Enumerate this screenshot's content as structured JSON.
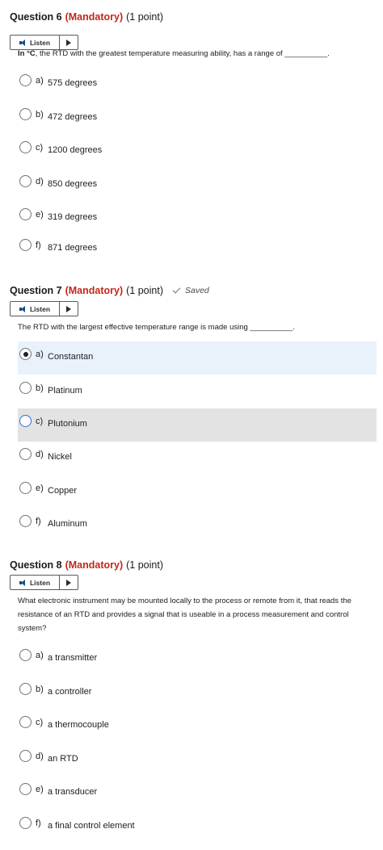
{
  "questions": [
    {
      "title": "Question 6",
      "mandatory": "(Mandatory)",
      "points": "(1 point)",
      "saved": "",
      "listen_label": "Listen",
      "text_bold": "In °C",
      "text": ", the RTD with the greatest temperature measuring ability, has a range of __________.",
      "options": [
        {
          "letter": "a)",
          "text": "575 degrees",
          "selected": false
        },
        {
          "letter": "b)",
          "text": "472 degrees",
          "selected": false
        },
        {
          "letter": "c)",
          "text": "1200 degrees",
          "selected": false
        },
        {
          "letter": "d)",
          "text": "850 degrees",
          "selected": false
        },
        {
          "letter": "e)",
          "text": "319 degrees",
          "selected": false
        },
        {
          "letter": "f)",
          "text": "871 degrees",
          "selected": false
        }
      ]
    },
    {
      "title": "Question 7",
      "mandatory": "(Mandatory)",
      "points": "(1 point)",
      "saved": "Saved",
      "listen_label": "Listen",
      "text_bold": "",
      "text": "The RTD with the largest effective temperature range is made using __________.",
      "options": [
        {
          "letter": "a)",
          "text": "Constantan",
          "selected": true
        },
        {
          "letter": "b)",
          "text": "Platinum",
          "selected": false
        },
        {
          "letter": "c)",
          "text": "Plutonium",
          "selected": false
        },
        {
          "letter": "d)",
          "text": "Nickel",
          "selected": false
        },
        {
          "letter": "e)",
          "text": "Copper",
          "selected": false
        },
        {
          "letter": "f)",
          "text": "Aluminum",
          "selected": false
        }
      ]
    },
    {
      "title": "Question 8",
      "mandatory": "(Mandatory)",
      "points": "(1 point)",
      "saved": "",
      "listen_label": "Listen",
      "text_bold": "",
      "text": "What electronic instrument may be mounted locally to the process or remote from it, that reads the resistance of an RTD and provides a signal that is useable in a process measurement and control system?",
      "options": [
        {
          "letter": "a)",
          "text": "a transmitter",
          "selected": false
        },
        {
          "letter": "b)",
          "text": "a controller",
          "selected": false
        },
        {
          "letter": "c)",
          "text": "a thermocouple",
          "selected": false
        },
        {
          "letter": "d)",
          "text": "an RTD",
          "selected": false
        },
        {
          "letter": "e)",
          "text": "a transducer",
          "selected": false
        },
        {
          "letter": "f)",
          "text": "a final control element",
          "selected": false
        }
      ]
    }
  ]
}
